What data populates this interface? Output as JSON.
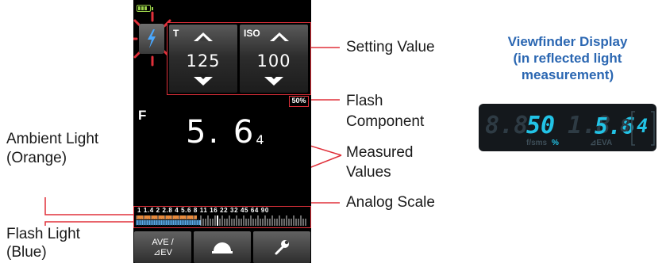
{
  "battery_icon": "battery-icon",
  "settings": {
    "shutter": {
      "label": "T",
      "value": "125"
    },
    "iso": {
      "label": "ISO",
      "value": "100"
    }
  },
  "flash_percent": "50%",
  "aperture_letter": "F",
  "measured": {
    "main": "5. 6",
    "sub": "4"
  },
  "analog_scale": {
    "numbers": "1  1.4  2  2.8  4  5.6  8  11  16  22  32  45  64  90",
    "ambient_color": "#e88a3c",
    "flash_color": "#5aa9e6"
  },
  "buttons": {
    "ave_line1": "AVE /",
    "ave_line2": "⊿EV",
    "dome_icon": "dome-icon",
    "wrench_icon": "wrench-icon"
  },
  "labels": {
    "setting_value": "Setting Value",
    "flash_component_1": "Flash",
    "flash_component_2": "Component",
    "measured_1": "Measured",
    "measured_2": "Values",
    "analog_scale": "Analog Scale",
    "ambient_1": "Ambient Light",
    "ambient_2": "(Orange)",
    "flashlight_1": "Flash Light",
    "flashlight_2": "(Blue)"
  },
  "viewfinder": {
    "title_1": "Viewfinder Display",
    "title_2": "(in reflected light",
    "title_3": "measurement)",
    "readout_percent": "50",
    "readout_fnumber": "5.6",
    "readout_sub": "4",
    "unit_fsms": "f/sms",
    "unit_percent": "%",
    "unit_eva": "⊿EVA"
  },
  "colors": {
    "callout_red": "#e0303a",
    "viewfinder_cyan": "#22c3e6",
    "viewfinder_title_blue": "#2b67b2"
  }
}
